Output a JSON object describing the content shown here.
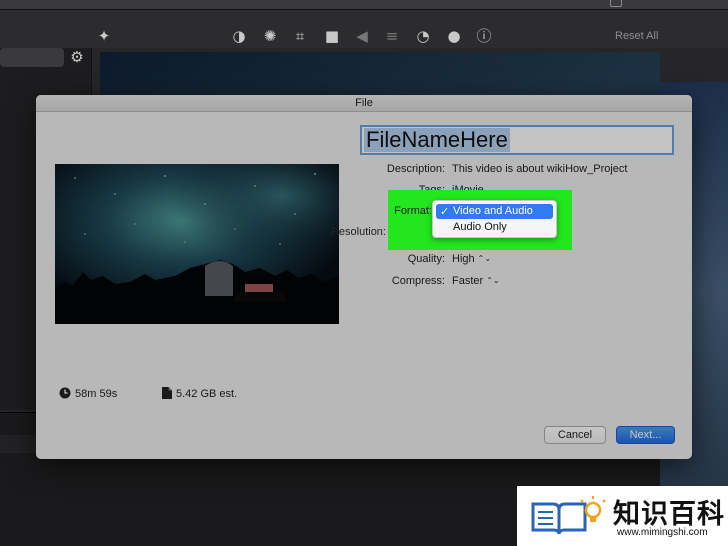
{
  "app": {
    "reset_all": "Reset All",
    "toolbar_icons": [
      "magic-wand-icon",
      "color-balance-icon",
      "palette-icon",
      "crop-icon",
      "camera-stabilize-icon",
      "volume-icon",
      "equalizer-icon",
      "speed-icon",
      "overlay-icon",
      "info-icon"
    ]
  },
  "dialog": {
    "title": "File",
    "filename": "FileNameHere",
    "fields": {
      "description_label": "Description:",
      "description_value": "This video is about wikiHow_Project",
      "tags_label": "Tags:",
      "tags_value": "iMovie",
      "format_label": "Format:",
      "resolution_label": "Resolution:",
      "quality_label": "Quality:",
      "quality_value": "High",
      "compress_label": "Compress:",
      "compress_value": "Faster"
    },
    "format_menu": {
      "options": [
        "Video and Audio",
        "Audio Only"
      ],
      "selected": "Video and Audio",
      "check": "✓"
    },
    "duration": "58m 59s",
    "file_size": "5.42 GB est.",
    "cancel_label": "Cancel",
    "next_label": "Next...",
    "chevron": "⌃⌄"
  },
  "colors": {
    "accent": "#2f7bf2",
    "highlight": "#22e61e",
    "filename_selection": "#b3cdee"
  },
  "watermark": {
    "text": "知识百科",
    "url": "www.mimingshi.com"
  }
}
